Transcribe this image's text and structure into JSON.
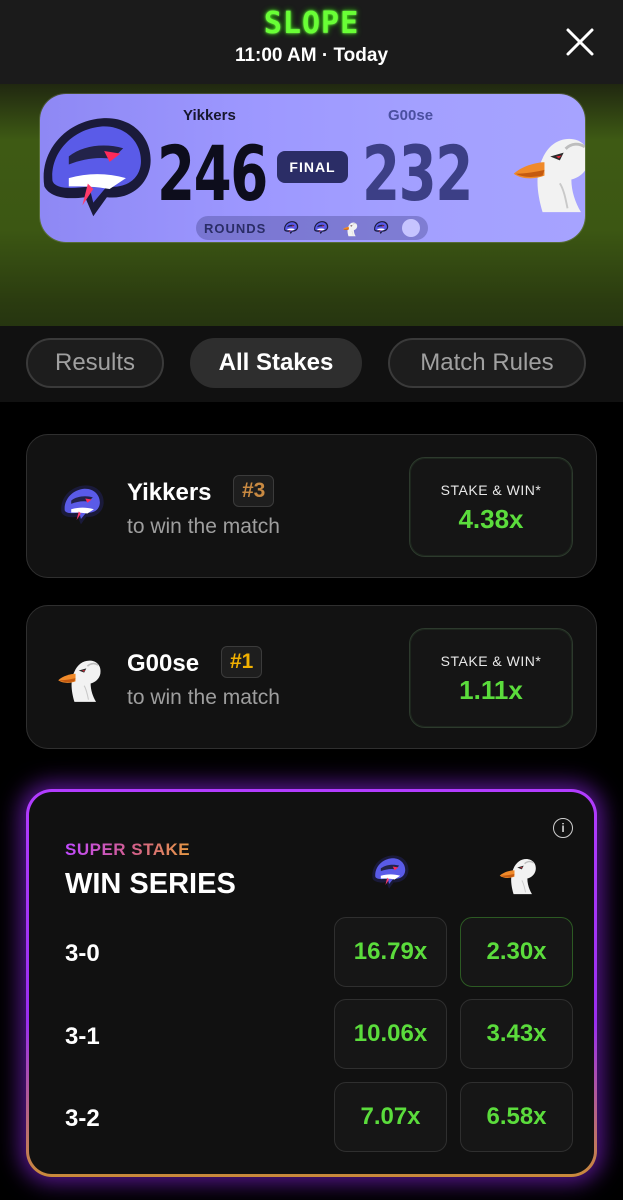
{
  "header": {
    "app_title": "SLOPE",
    "time_label": "11:00 AM · Today"
  },
  "scoreboard": {
    "team_a": {
      "name": "Yikkers",
      "score": "246"
    },
    "team_b": {
      "name": "G00se",
      "score": "232"
    },
    "status": "FINAL",
    "rounds_label": "ROUNDS",
    "rounds_winners": [
      "Yikkers",
      "Yikkers",
      "G00se",
      "Yikkers"
    ],
    "rounds_remaining": 1
  },
  "tabs": [
    {
      "label": "Results",
      "active": false
    },
    {
      "label": "All Stakes",
      "active": true
    },
    {
      "label": "Match Rules",
      "active": false
    }
  ],
  "stakes": [
    {
      "team": "Yikkers",
      "rank": "#3",
      "subtitle": "to win the match",
      "button_label": "STAKE & WIN*",
      "multiplier": "4.38x",
      "logo": "viper-icon"
    },
    {
      "team": "G00se",
      "rank": "#1",
      "subtitle": "to win the match",
      "button_label": "STAKE & WIN*",
      "multiplier": "1.11x",
      "logo": "goose-icon"
    }
  ],
  "super_stake": {
    "kicker": "SUPER STAKE",
    "title": "WIN SERIES",
    "info_symbol": "i",
    "rows": [
      {
        "score": "3-0",
        "team_a": "16.79x",
        "team_b": "2.30x"
      },
      {
        "score": "3-1",
        "team_a": "10.06x",
        "team_b": "3.43x"
      },
      {
        "score": "3-2",
        "team_a": "7.07x",
        "team_b": "6.58x"
      }
    ]
  },
  "colors": {
    "accent_green": "#5bdc3c",
    "title_green": "#69ff36",
    "super_purple": "#b23cff",
    "score_card": "#9d98ff"
  }
}
